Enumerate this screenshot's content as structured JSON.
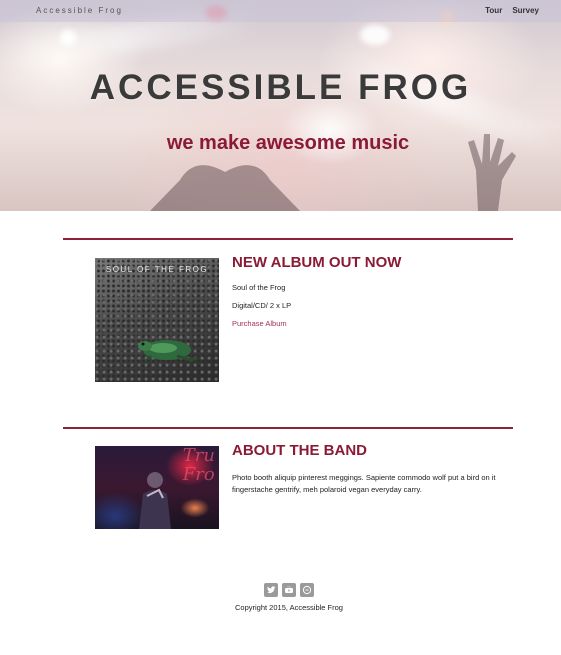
{
  "header": {
    "brand": "Accessible Frog",
    "nav": [
      {
        "label": "Tour"
      },
      {
        "label": "Survey"
      }
    ]
  },
  "hero": {
    "title": "ACCESSIBLE FROG",
    "subtitle": "we make awesome music"
  },
  "album": {
    "heading": "NEW ALBUM OUT NOW",
    "cover_text": "SOUL OF THE FROG",
    "name": "Soul of the Frog",
    "formats": "Digital/CD/ 2 x LP",
    "purchase_label": "Purchase Album"
  },
  "about": {
    "heading": "ABOUT THE BAND",
    "photo_text": "Tru\nFro",
    "text": "Photo booth aliquip pinterest meggings. Sapiente commodo wolf put a bird on it fingerstache gentrify, meh polaroid vegan everyday carry."
  },
  "footer": {
    "social": [
      {
        "icon": "twitter-icon"
      },
      {
        "icon": "youtube-icon"
      },
      {
        "icon": "chat-icon"
      }
    ],
    "copyright": "Copyright 2015, Accessible Frog"
  },
  "colors": {
    "accent": "#8a1a36",
    "rule": "#8e1f3d",
    "link": "#a0305a"
  }
}
